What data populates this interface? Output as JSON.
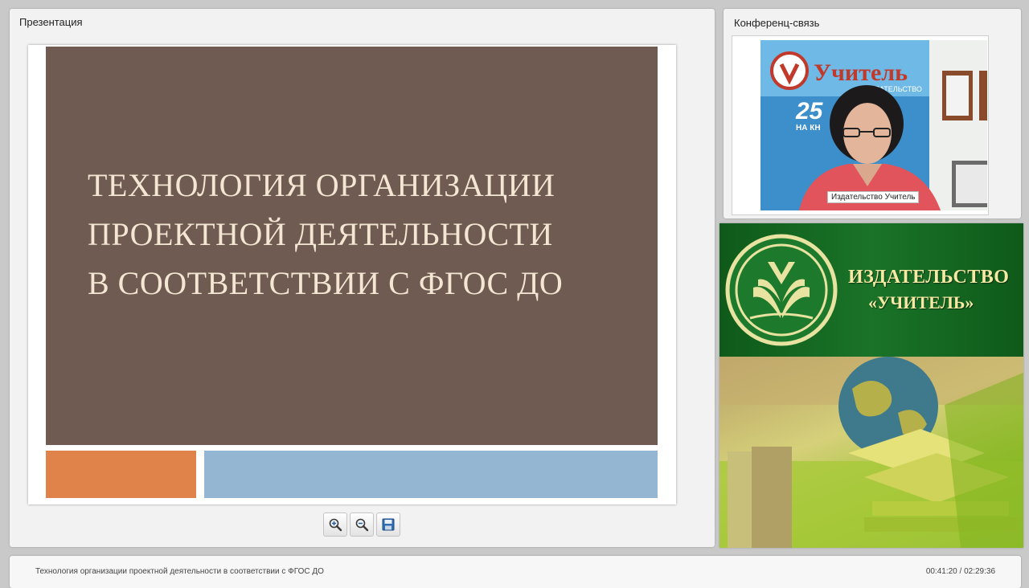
{
  "presentation": {
    "panel_title": "Презентация",
    "slide": {
      "title_lines": [
        "ТЕХНОЛОГИЯ ОРГАНИЗАЦИИ",
        "ПРОЕКТНОЙ ДЕЯТЕЛЬНОСТИ",
        "В СООТВЕТСТВИИ С ФГОС ДО"
      ],
      "colors": {
        "main": "#6f5b52",
        "orange": "#e0834a",
        "blue": "#94b6d2",
        "text": "#f3e6d2"
      }
    },
    "toolbar": {
      "zoom_in_icon": "zoom-in-icon",
      "zoom_out_icon": "zoom-out-icon",
      "save_icon": "save-icon"
    }
  },
  "conference": {
    "panel_title": "Конференц-связь",
    "video_label": "Издательство Учитель",
    "poster_text": "Учитель",
    "poster_sub": "ИЗДАТЕЛЬСТВО",
    "poster_number": "25",
    "poster_caption": "НА КН"
  },
  "banner": {
    "line1": "ИЗДАТЕЛЬСТВО",
    "line2": "«УЧИТЕЛЬ»"
  },
  "bottom_bar": {
    "title": "Технология организации проектной деятельности в соответствии с ФГОС ДО",
    "time": "00:41:20 / 02:29:36"
  }
}
